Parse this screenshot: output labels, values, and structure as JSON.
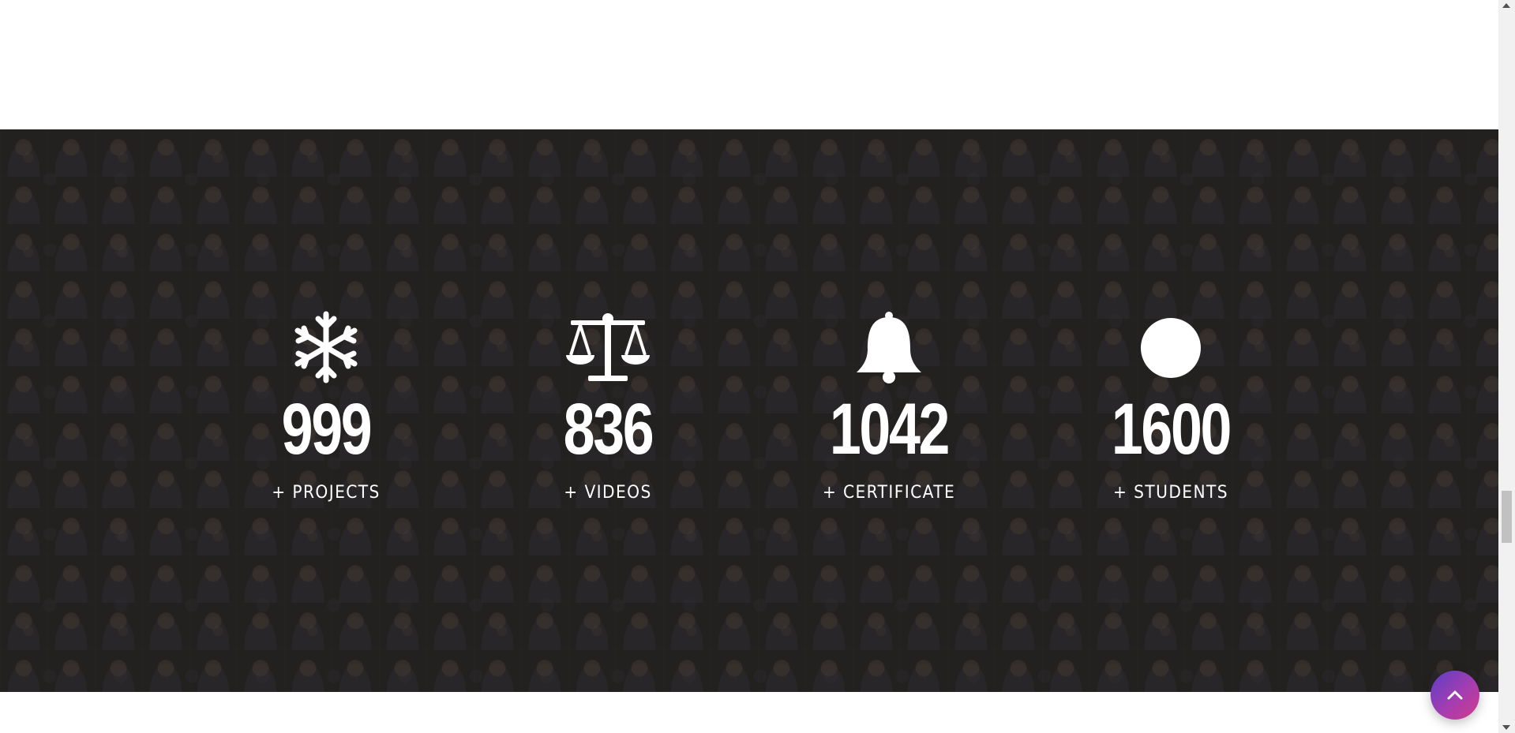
{
  "stats": [
    {
      "icon": "snowflake-icon",
      "number": "999",
      "label": "+ PROJECTS"
    },
    {
      "icon": "balance-scale-icon",
      "number": "836",
      "label": "+ VIDEOS"
    },
    {
      "icon": "bell-icon",
      "number": "1042",
      "label": "+ CERTIFICATE"
    },
    {
      "icon": "circle-icon",
      "number": "1600",
      "label": "+ STUDENTS"
    }
  ],
  "back_to_top": {
    "icon": "chevron-up-icon"
  },
  "colors": {
    "section_bg": "#2a2828",
    "text": "#ffffff",
    "button_gradient_start": "#5b3fc7",
    "button_gradient_end": "#d23b8c"
  }
}
